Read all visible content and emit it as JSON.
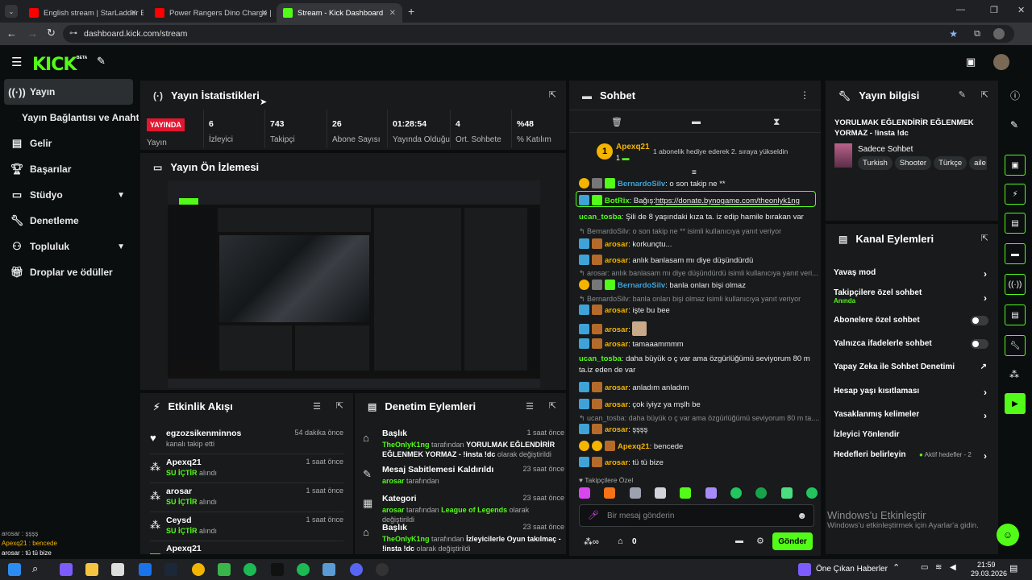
{
  "browser": {
    "tabs": [
      {
        "title": "English stream | StarLadder Bu:"
      },
      {
        "title": "Power Rangers Dino Charge | S"
      },
      {
        "title": "Stream - Kick Dashboard"
      }
    ],
    "url": "dashboard.kick.com/stream"
  },
  "header": {
    "logo": "KICK",
    "logo_sup": "BETA"
  },
  "sidebar": {
    "items": [
      {
        "label": "Yayın"
      },
      {
        "label": "Yayın Bağlantısı ve Anahtarı"
      },
      {
        "label": "Gelir"
      },
      {
        "label": "Başarılar"
      },
      {
        "label": "Stüdyo"
      },
      {
        "label": "Denetleme"
      },
      {
        "label": "Topluluk"
      },
      {
        "label": "Droplar ve ödüller"
      }
    ]
  },
  "stats": {
    "title": "Yayın İstatistikleri",
    "live_badge": "YAYINDA",
    "live_label": "Yayın",
    "items": [
      {
        "value": "6",
        "label": "İzleyici"
      },
      {
        "value": "743",
        "label": "Takipçi"
      },
      {
        "value": "26",
        "label": "Abone Sayısı"
      },
      {
        "value": "01:28:54",
        "label": "Yayında Olduğu"
      },
      {
        "value": "4",
        "label": "Ort. Sohbete"
      },
      {
        "value": "%48",
        "label": "% Katılım"
      }
    ]
  },
  "preview": {
    "title": "Yayın Ön İzlemesi"
  },
  "activity": {
    "title": "Etkinlik Akışı",
    "rows": [
      {
        "name": "egzozsikenminnos",
        "sub": "kanalı takip etti",
        "time": "54 dakika önce"
      },
      {
        "name": "Apexq21",
        "sub_hl": "SU İÇTİR",
        "sub": "alındı",
        "time": "1 saat önce"
      },
      {
        "name": "arosar",
        "sub_hl": "SU İÇTİR",
        "sub": "alındı",
        "time": "1 saat önce"
      },
      {
        "name": "Ceysd",
        "sub_hl": "SU İÇTİR",
        "sub": "alındı",
        "time": "1 saat önce"
      },
      {
        "name": "Apexq21"
      }
    ]
  },
  "modlog": {
    "title": "Denetim Eylemleri",
    "rows": [
      {
        "title": "Başlık",
        "time": "1 saat önce",
        "actor": "TheOnlyK1ng",
        "t1": "tarafından",
        "b1": "YORULMAK EĞLENDİRİR EĞLENMEK YORMAZ - !insta !dc",
        "t2": "olarak değiştirildi"
      },
      {
        "title": "Mesaj Sabitlemesi Kaldırıldı",
        "time": "23 saat önce",
        "actor": "arosar",
        "t1": "tarafından"
      },
      {
        "title": "Kategori",
        "time": "23 saat önce",
        "actor": "arosar",
        "t1": "tarafından",
        "b1g": "League of Legends",
        "t2": "olarak değiştirildi"
      },
      {
        "title": "Başlık",
        "time": "23 saat önce",
        "actor": "TheOnlyK1ng",
        "t1": "tarafından",
        "b1": "İzleyicilerle Oyun takılmaç - !insta !dc",
        "t2": "olarak değiştirildi"
      }
    ]
  },
  "chat": {
    "title": "Sohbet",
    "pinned_user": "Apexq21",
    "pinned_num": "1",
    "pinned_text": "1 abonelik hediye ederek 2. sıraya yükseldin",
    "messages": [
      {
        "user": "BernardoSilv",
        "text": ": o son takip ne **"
      },
      {
        "user": "BotRix",
        "text": ": Bağış:",
        "link": "https://donate.bynogame.com/theonlyk1ng"
      },
      {
        "user": "ucan_tosba",
        "text": ": Şili de 8 yaşındaki kıza ta. iz edip hamile bırakan var"
      },
      {
        "reply": "BernardoSilv: o son takip ne ** isimli kullanıcıya yanıt veriyor"
      },
      {
        "user": "arosar",
        "text": ": korkunçtu..."
      },
      {
        "user": "arosar",
        "text": ": anlık banlasam mı diye düşündürdü"
      },
      {
        "reply": "arosar: anlık banlasam mı diye düşündürdü isimli kullanıcıya yanıt veri..."
      },
      {
        "user": "BernardoSilv",
        "text": ": banla onları bişi olmaz"
      },
      {
        "reply": "BernardoSilv: banla onları bişi olmaz isimli kullanıcıya yanıt veriyor"
      },
      {
        "user": "arosar",
        "text": ": işte bu bee"
      },
      {
        "user": "arosar",
        "text": ":"
      },
      {
        "user": "arosar",
        "text": ": tamaaammmm"
      },
      {
        "user": "ucan_tosba",
        "text": ": daha büyük o ç var ama özgürlüğümü seviyorum 80 m ta.iz eden de var"
      },
      {
        "user": "arosar",
        "text": ": anladım anladım"
      },
      {
        "user": "arosar",
        "text": ": çok iyiyz ya mşlh be"
      },
      {
        "reply": "ucan_tosba: daha büyük o ç var ama özgürlüğümü seviyorum 80 m ta...."
      },
      {
        "user": "arosar",
        "text": ": şşşş"
      },
      {
        "user": "Apexq21",
        "text": ": bencede"
      },
      {
        "user": "arosar",
        "text": ": tü tü bize"
      }
    ],
    "followers_only": "Takipçilere Özel",
    "input_placeholder": "Bir mesaj gönderin",
    "points": "0",
    "send": "Gönder"
  },
  "stream_info": {
    "title": "Yayın bilgisi",
    "stream_title": "YORULMAK EĞLENDİRİR EĞLENMEK YORMAZ - !insta !dc",
    "category": "Sadece Sohbet",
    "tags": [
      "Turkish",
      "Shooter",
      "Türkçe",
      "aile"
    ]
  },
  "channel_actions": {
    "title": "Kanal Eylemleri",
    "items": [
      {
        "label": "Yavaş mod",
        "type": "arrow"
      },
      {
        "label": "Takipçilere özel sohbet",
        "sub": "Anında",
        "type": "arrow"
      },
      {
        "label": "Abonelere özel sohbet",
        "type": "toggle"
      },
      {
        "label": "Yalnızca ifadelerle sohbet",
        "type": "toggle"
      },
      {
        "label": "Yapay Zeka ile Sohbet Denetimi",
        "type": "ext"
      },
      {
        "label": "Hesap yaşı kısıtlaması",
        "type": "arrow"
      },
      {
        "label": "Yasaklanmış kelimeler",
        "type": "arrow"
      },
      {
        "label": "İzleyici Yönlendir",
        "type": "none"
      },
      {
        "label": "Hedefleri belirleyin",
        "sub": "Aktif hedefler - 2",
        "type": "arrow"
      }
    ]
  },
  "overlay": {
    "lines": [
      "arosar : şşşş",
      "Apexq21 : bencede",
      "arosar : tü tü bize"
    ]
  },
  "watermark": {
    "line1": "Windows'u Etkinleştir",
    "line2": "Windows'u etkinleştirmek için Ayarlar'a gidin."
  },
  "taskbar": {
    "news": "Öne Çıkan Haberler",
    "time": "21:59",
    "date": "29.03.2026"
  },
  "colors": {
    "accent": "#53fc18",
    "live": "#e4162f",
    "panel": "#181a1b",
    "bg": "#0b0e0f"
  }
}
